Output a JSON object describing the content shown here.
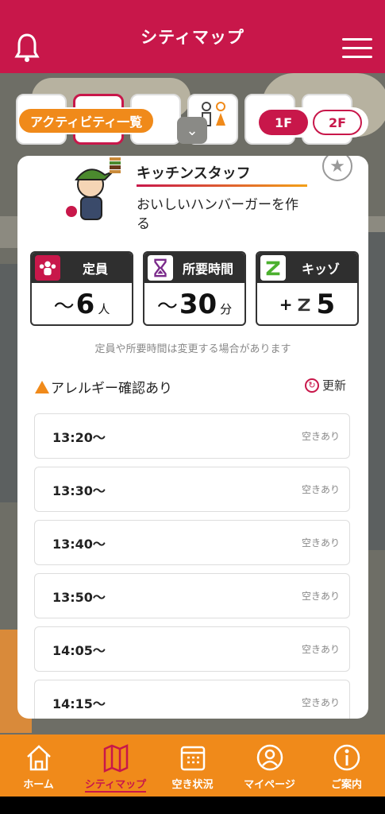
{
  "header": {
    "title": "シティマップ",
    "bell_icon": "bell-icon",
    "menu_icon": "hamburger-menu-icon"
  },
  "colors": {
    "brand": "#c8174a",
    "accent": "#f08a1a"
  },
  "map_controls": {
    "activity_button": "アクティビティ一覧",
    "floors": [
      "1F",
      "2F"
    ],
    "selected_floor": "1F"
  },
  "activity": {
    "title": "キッチンスタッフ",
    "description": "おいしいハンバーガーを作る",
    "stats": {
      "capacity": {
        "label": "定員",
        "prefix": "〜",
        "value": "6",
        "unit": "人"
      },
      "duration": {
        "label": "所要時間",
        "prefix": "〜",
        "value": "30",
        "unit": "分"
      },
      "kidzo": {
        "label": "キッゾ",
        "prefix": "+",
        "value": "5"
      }
    },
    "note": "定員や所要時間は変更する場合があります",
    "allergy": "アレルギー確認あり",
    "refresh": "更新",
    "slots": [
      {
        "time": "13:20〜",
        "status": "空きあり"
      },
      {
        "time": "13:30〜",
        "status": "空きあり"
      },
      {
        "time": "13:40〜",
        "status": "空きあり"
      },
      {
        "time": "13:50〜",
        "status": "空きあり"
      },
      {
        "time": "14:05〜",
        "status": "空きあり"
      },
      {
        "time": "14:15〜",
        "status": "空きあり"
      }
    ]
  },
  "bottom_nav": [
    {
      "label": "ホーム",
      "icon": "home-icon"
    },
    {
      "label": "シティマップ",
      "icon": "map-icon",
      "active": true
    },
    {
      "label": "空き状況",
      "icon": "calendar-icon"
    },
    {
      "label": "マイページ",
      "icon": "user-icon"
    },
    {
      "label": "ご案内",
      "icon": "info-icon"
    }
  ]
}
